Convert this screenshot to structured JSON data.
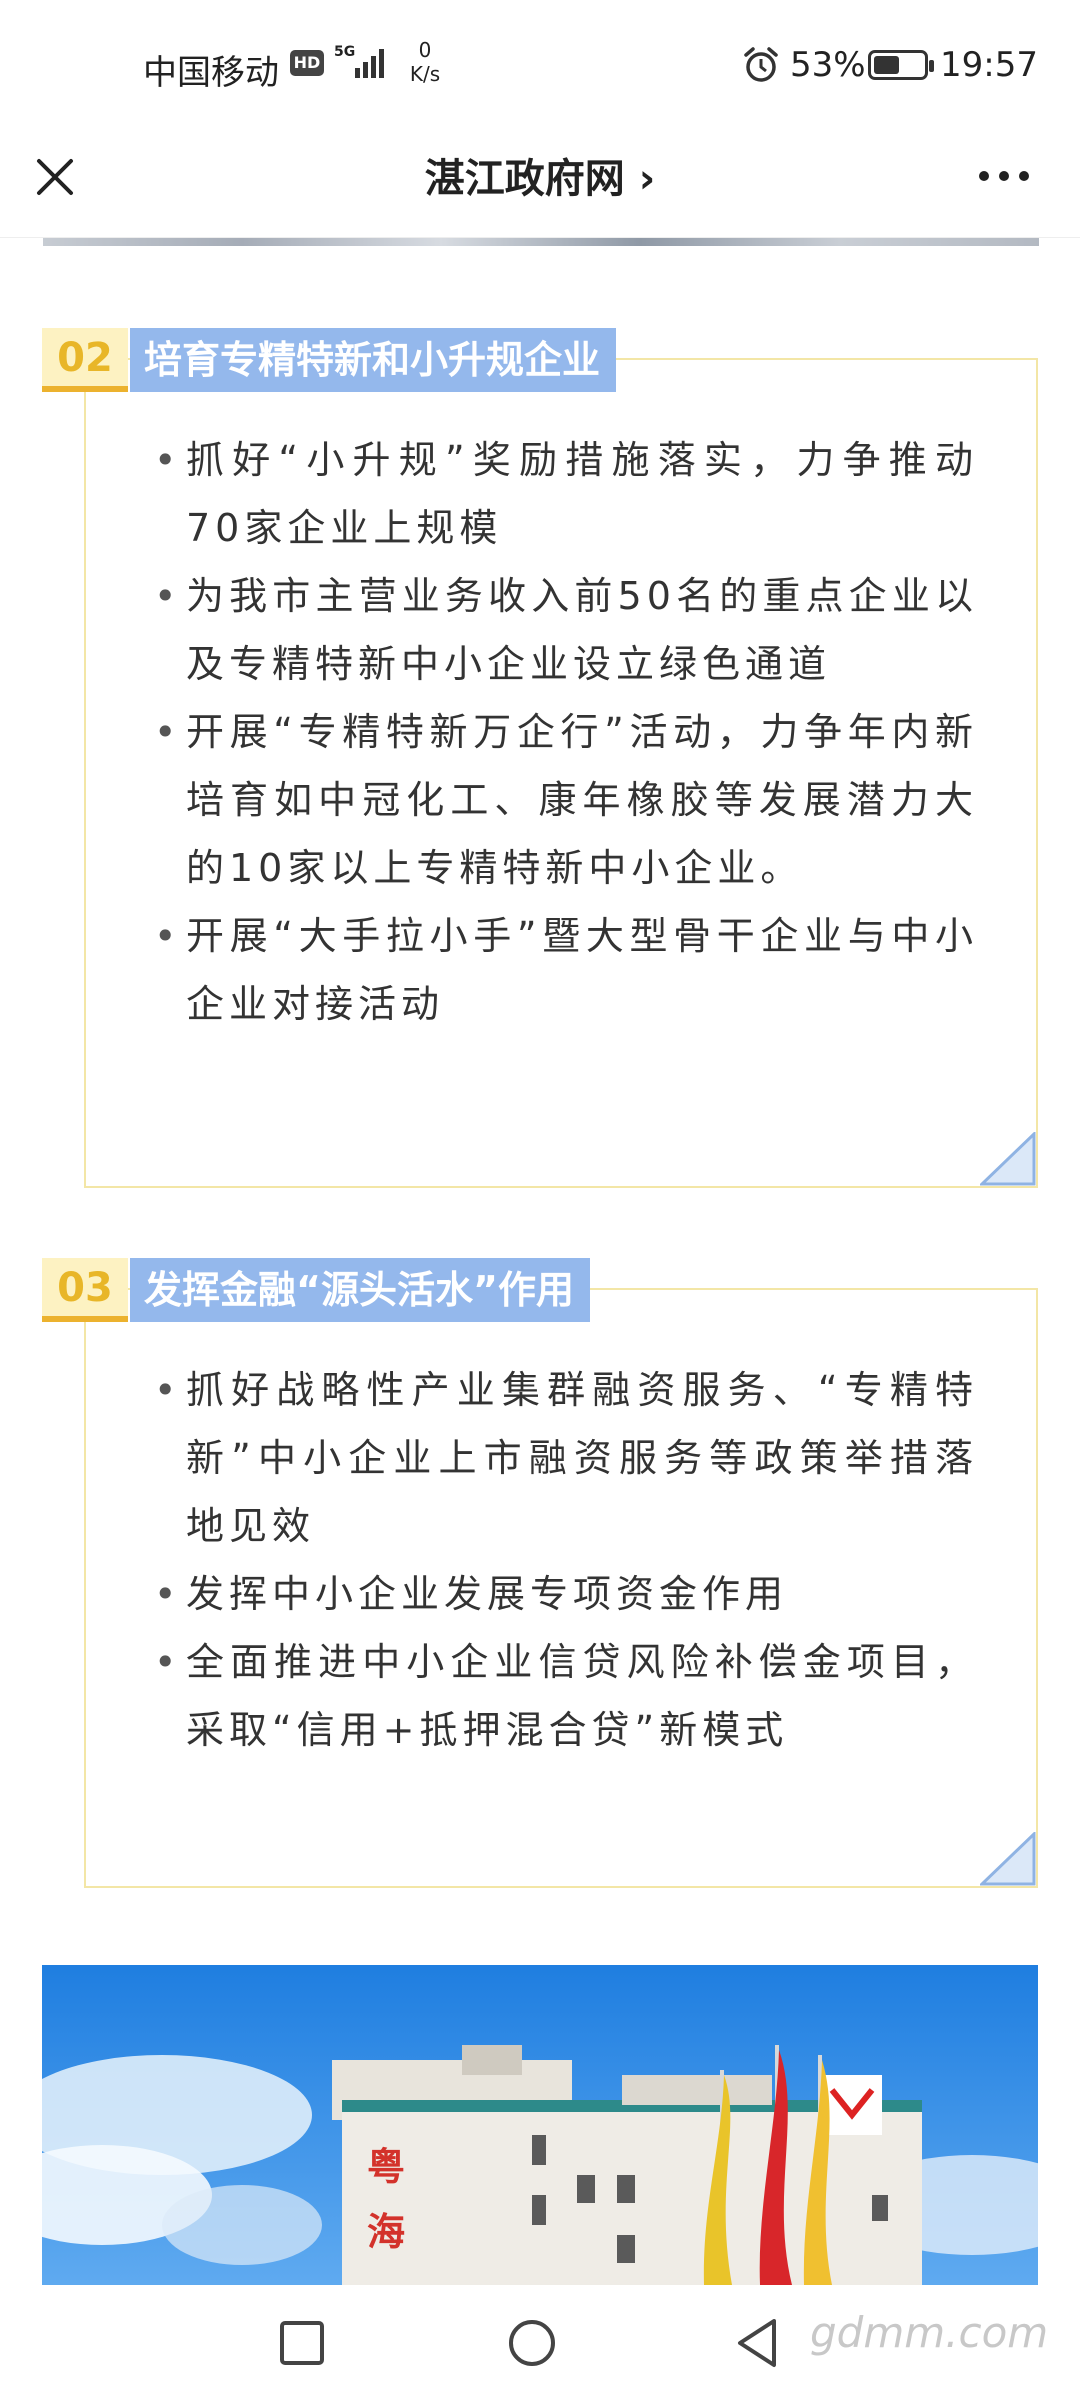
{
  "status_bar": {
    "carrier": "中国移动",
    "hd_badge": "HD",
    "network": "5G",
    "speed_value": "0",
    "speed_unit": "K/s",
    "battery_percent": "53%",
    "battery_level": 0.53,
    "time": "19:57",
    "icons": [
      "signal-icon",
      "alarm-icon",
      "battery-icon"
    ]
  },
  "nav": {
    "title": "湛江政府网 ›",
    "close_icon": "close-icon",
    "more_icon": "more-icon"
  },
  "sections": [
    {
      "number": "02",
      "title": "培育专精特新和小升规企业",
      "bullets": [
        "抓好“小升规”奖励措施落实，力争推动70家企业上规模",
        "为我市主营业务收入前50名的重点企业以及专精特新中小企业设立绿色通道",
        "开展“专精特新万企行”活动，力争年内新培育如中冠化工、康年橡胶等发展潜力大的10家以上专精特新中小企业。",
        "开展“大手拉小手”暨大型骨干企业与中小企业对接活动"
      ]
    },
    {
      "number": "03",
      "title": "发挥金融“源头活水”作用",
      "bullets": [
        "抓好战略性产业集群融资服务、“专精特新”中小企业上市融资服务等政策举措落地见效",
        "发挥中小企业发展专项资金作用",
        "全面推进中小企业信贷风险补偿金项目，采取“信用+抵押混合贷”新模式"
      ]
    }
  ],
  "photo": {
    "sign_chars": [
      "粤",
      "海"
    ]
  },
  "bottom_nav": {
    "icons": [
      "recent-apps-icon",
      "home-icon",
      "back-icon"
    ]
  },
  "watermark": "gdmm.com",
  "colors": {
    "number_bg": "#fdf2c2",
    "number_text": "#e8b628",
    "title_bg": "#94b8ec",
    "frame": "#f3e6a6",
    "corner": "#8fb3e3"
  }
}
